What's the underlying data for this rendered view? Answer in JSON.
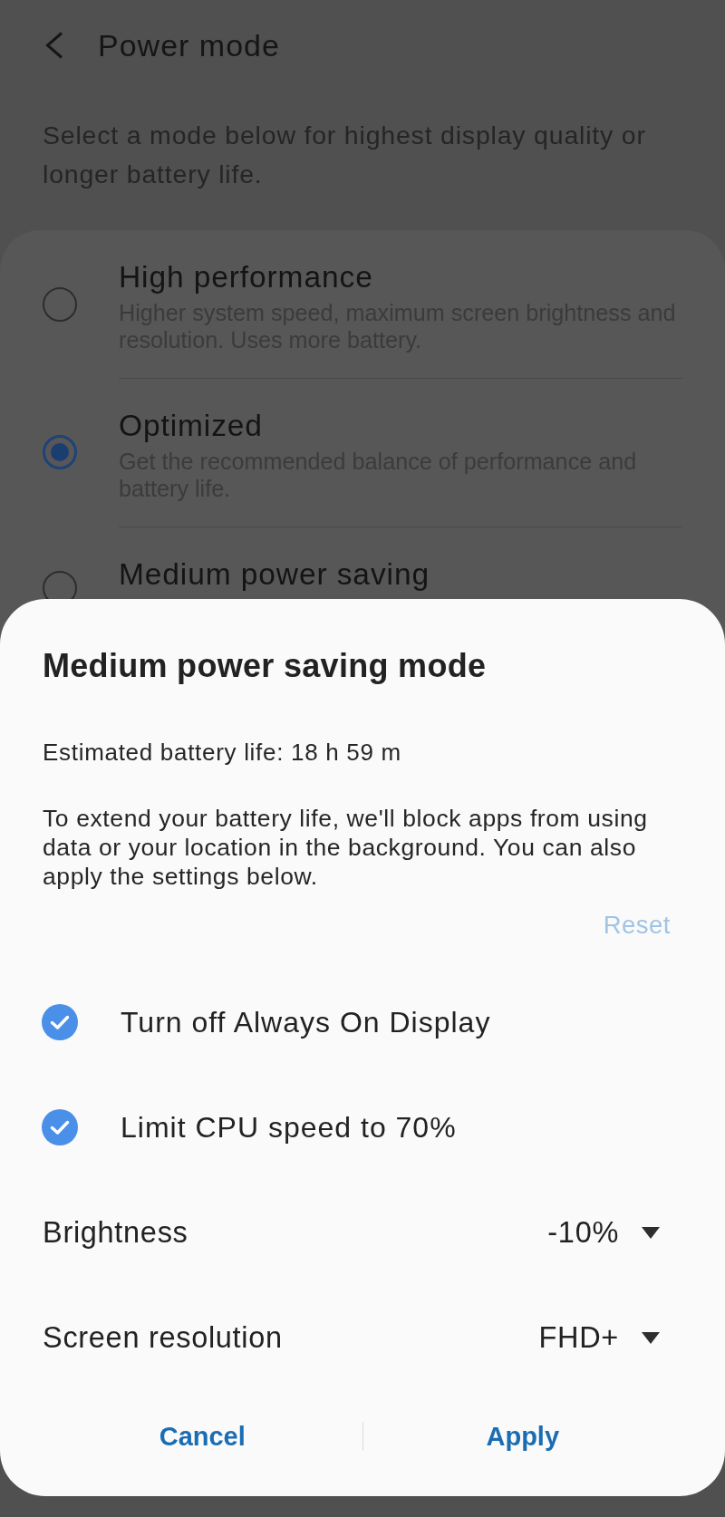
{
  "header": {
    "title": "Power mode"
  },
  "description": "Select a mode below for highest display quality or longer battery life.",
  "modes": [
    {
      "title": "High performance",
      "subtitle": "Higher system speed, maximum screen brightness and resolution. Uses more battery.",
      "selected": false
    },
    {
      "title": "Optimized",
      "subtitle": "Get the recommended balance of performance and battery life.",
      "selected": true
    },
    {
      "title": "Medium power saving",
      "selected": false
    }
  ],
  "dialog": {
    "title": "Medium power saving mode",
    "estimate": "Estimated battery life: 18 h 59 m",
    "message": "To extend your battery life, we'll block apps from using data or your location in the background. You can also apply the settings below.",
    "reset": {
      "label": "Reset",
      "disabled": true
    },
    "options": [
      {
        "kind": "checkbox",
        "label": "Turn off Always On Display",
        "checked": true
      },
      {
        "kind": "checkbox",
        "label": "Limit CPU speed to 70%",
        "checked": true
      },
      {
        "kind": "dropdown",
        "label": "Brightness",
        "value": "-10%"
      },
      {
        "kind": "dropdown",
        "label": "Screen resolution",
        "value": "FHD+"
      }
    ],
    "buttons": [
      "Cancel",
      "Apply"
    ]
  }
}
